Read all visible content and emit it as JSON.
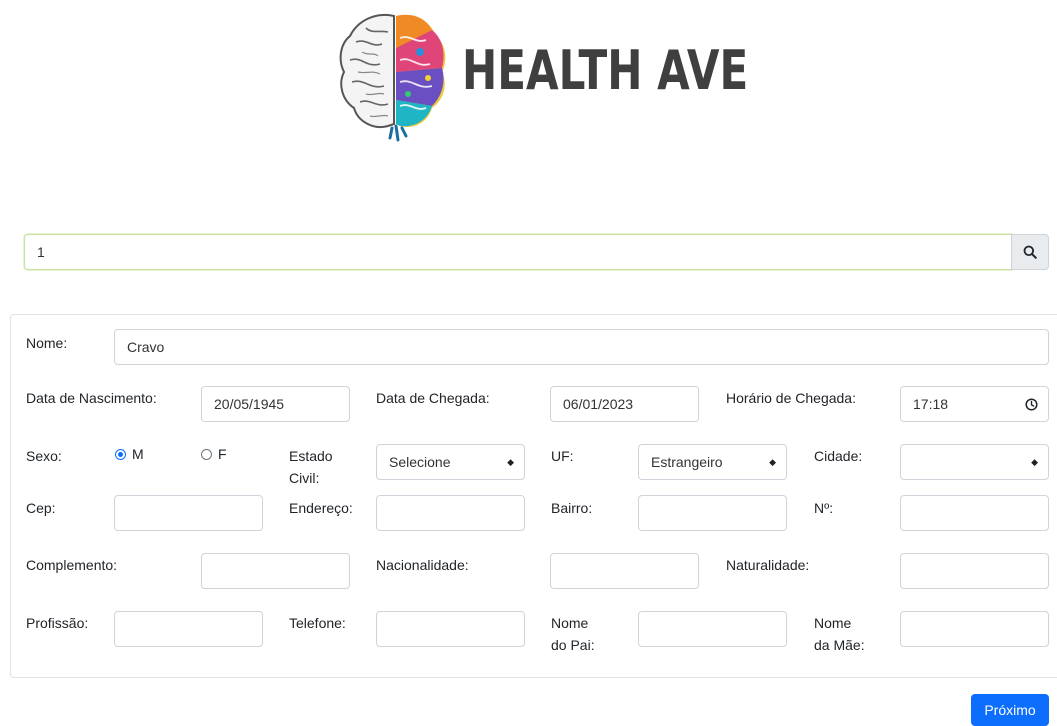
{
  "brand": {
    "name": "HEALTH AVE"
  },
  "search": {
    "value": "1",
    "icon": "search-icon"
  },
  "form": {
    "nome": {
      "label": "Nome:",
      "value": "Cravo"
    },
    "data_nascimento": {
      "label": "Data de Nascimento:",
      "value": "20/05/1945"
    },
    "data_chegada": {
      "label": "Data de Chegada:",
      "value": "06/01/2023"
    },
    "horario_chegada": {
      "label": "Horário de Chegada:",
      "value": "17:18",
      "icon": "clock-icon"
    },
    "sexo": {
      "label": "Sexo:",
      "options": [
        {
          "label": "M",
          "checked": true
        },
        {
          "label": "F",
          "checked": false
        }
      ]
    },
    "estado_civil": {
      "label_line1": "Estado",
      "label_line2": "Civil:",
      "value": "Selecione"
    },
    "uf": {
      "label": "UF:",
      "value": "Estrangeiro"
    },
    "cidade": {
      "label": "Cidade:",
      "value": ""
    },
    "cep": {
      "label": "Cep:",
      "value": ""
    },
    "endereco": {
      "label": "Endereço:",
      "value": ""
    },
    "bairro": {
      "label": "Bairro:",
      "value": ""
    },
    "numero": {
      "label": "Nº:",
      "value": ""
    },
    "complemento": {
      "label": "Complemento:",
      "value": ""
    },
    "nacionalidade": {
      "label": "Nacionalidade:",
      "value": ""
    },
    "naturalidade": {
      "label": "Naturalidade:",
      "value": ""
    },
    "profissao": {
      "label": "Profissão:",
      "value": ""
    },
    "telefone": {
      "label": "Telefone:",
      "value": ""
    },
    "nome_pai": {
      "label_line1": "Nome",
      "label_line2": "do Pai:",
      "value": ""
    },
    "nome_mae": {
      "label_line1": "Nome",
      "label_line2": "da Mãe:",
      "value": ""
    }
  },
  "actions": {
    "next_label": "Próximo"
  },
  "colors": {
    "primary": "#0d6efd",
    "search_focus_border": "#c6e3a0",
    "logo_text": "#3f3f3f"
  }
}
